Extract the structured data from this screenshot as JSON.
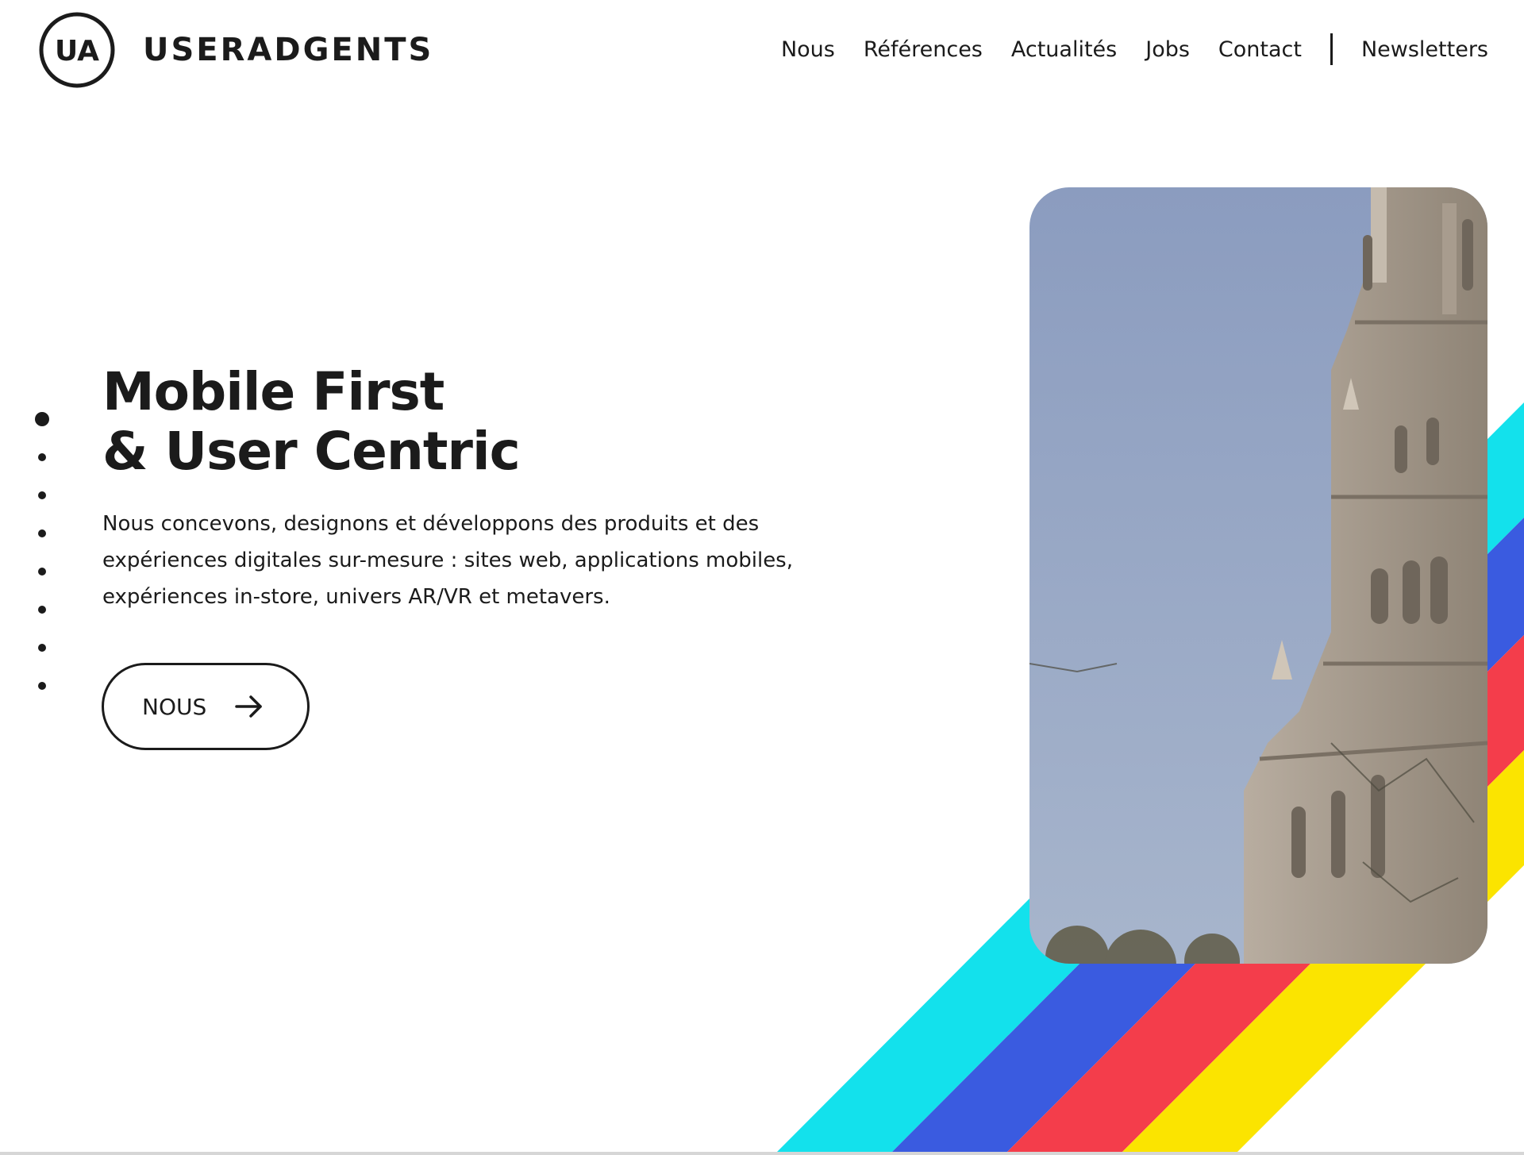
{
  "brand": {
    "monogram": "UA",
    "name": "USERADGENTS"
  },
  "nav": {
    "items": [
      "Nous",
      "Références",
      "Actualités",
      "Jobs",
      "Contact"
    ],
    "newsletters": "Newsletters"
  },
  "slider": {
    "dot_count": 8,
    "active_index": 0
  },
  "hero": {
    "title_line1": "Mobile First",
    "title_line2": "& User Centric",
    "description_lines": [
      "Nous concevons, designons et développons des produits et des",
      "expériences digitales sur-mesure : sites web, applications mobiles,",
      "expériences in-store, univers AR/VR et metavers."
    ],
    "cta_label": "NOUS",
    "cta_icon": "arrow-right-icon"
  },
  "colors": {
    "text": "#1b1b1b",
    "stripe_cyan": "#13e1ec",
    "stripe_blue": "#3a5be0",
    "stripe_red": "#f43d4b",
    "stripe_yellow": "#fbe400",
    "sky": "#9aaac8"
  }
}
